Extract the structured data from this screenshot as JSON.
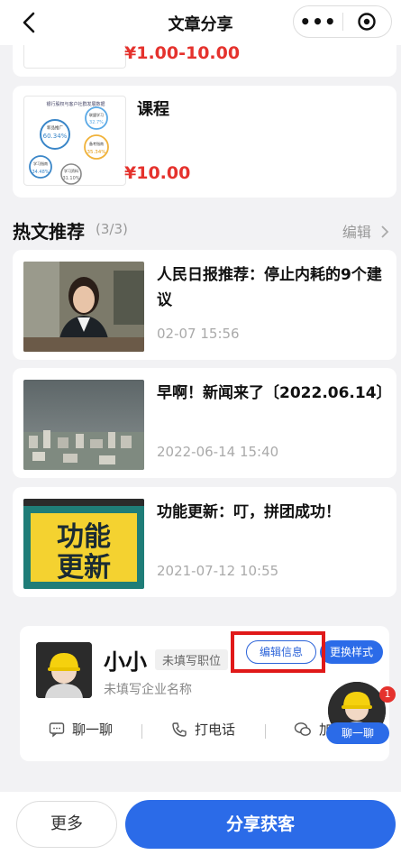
{
  "header": {
    "title": "文章分享"
  },
  "products": [
    {
      "price": "¥1.00-10.00"
    },
    {
      "name": "课程",
      "price": "¥10.00",
      "thumb_title": "银行股权与客户社群发展数据",
      "thumb_stats": [
        {
          "label": "新品推广",
          "value": "60.34%"
        },
        {
          "label": "联盟学习",
          "value": "32.7%"
        },
        {
          "label": "备考指南",
          "value": "35.34%"
        },
        {
          "label": "学习指南",
          "value": "34.48%"
        },
        {
          "label": "学习资料",
          "value": "31.10%"
        }
      ]
    }
  ],
  "hot": {
    "title": "热文推荐",
    "count": "(3/3)",
    "edit": "编辑"
  },
  "articles": [
    {
      "title": "人民日报推荐：停止内耗的9个建议",
      "time": "02-07 15:56"
    },
    {
      "title": "早啊！新闻来了〔2022.06.14〕",
      "time": "2022-06-14 15:40"
    },
    {
      "title": "功能更新：叮，拼团成功！",
      "time": "2021-07-12 10:55",
      "image_text_1": "功能",
      "image_text_2": "更新"
    }
  ],
  "card": {
    "name": "小小",
    "position": "未填写职位",
    "company": "未填写企业名称",
    "edit_btn": "编辑信息",
    "style_btn": "更换样式",
    "actions": {
      "chat": "聊一聊",
      "call": "打电话",
      "add": "加"
    }
  },
  "float": {
    "badge": "1",
    "label": "聊一聊"
  },
  "bottom": {
    "more": "更多",
    "share": "分享获客"
  },
  "colors": {
    "accent": "#2b6be8",
    "price": "#e5322d",
    "highlight_box": "#e01919"
  }
}
